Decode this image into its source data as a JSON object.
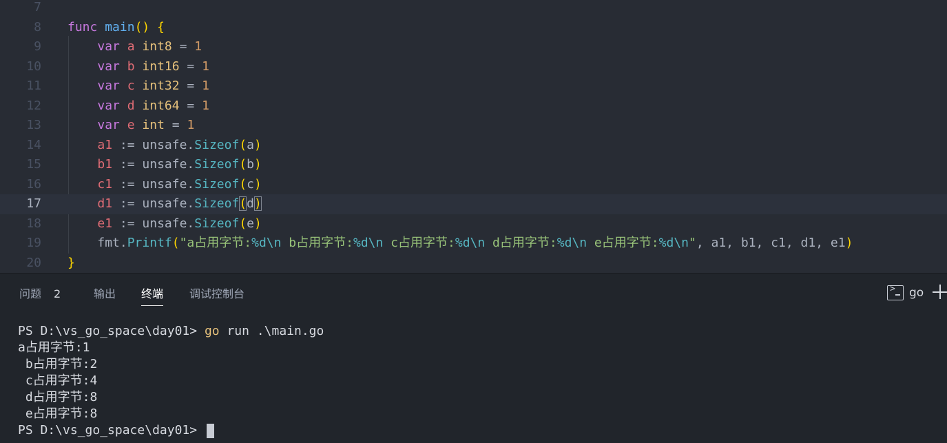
{
  "editor": {
    "lines": [
      {
        "n": "7",
        "tokens": []
      },
      {
        "n": "8",
        "tokens": [
          {
            "t": "func",
            "c": "kw"
          },
          {
            "t": " ",
            "c": "pl"
          },
          {
            "t": "main",
            "c": "fn"
          },
          {
            "t": "()",
            "c": "brk"
          },
          {
            "t": " ",
            "c": "pl"
          },
          {
            "t": "{",
            "c": "brk"
          }
        ]
      },
      {
        "n": "9",
        "tokens": [
          {
            "t": "    ",
            "c": "pl"
          },
          {
            "t": "var",
            "c": "kw"
          },
          {
            "t": " ",
            "c": "pl"
          },
          {
            "t": "a",
            "c": "var"
          },
          {
            "t": " ",
            "c": "pl"
          },
          {
            "t": "int8",
            "c": "typ"
          },
          {
            "t": " = ",
            "c": "pl"
          },
          {
            "t": "1",
            "c": "num"
          }
        ]
      },
      {
        "n": "10",
        "tokens": [
          {
            "t": "    ",
            "c": "pl"
          },
          {
            "t": "var",
            "c": "kw"
          },
          {
            "t": " ",
            "c": "pl"
          },
          {
            "t": "b",
            "c": "var"
          },
          {
            "t": " ",
            "c": "pl"
          },
          {
            "t": "int16",
            "c": "typ"
          },
          {
            "t": " = ",
            "c": "pl"
          },
          {
            "t": "1",
            "c": "num"
          }
        ]
      },
      {
        "n": "11",
        "tokens": [
          {
            "t": "    ",
            "c": "pl"
          },
          {
            "t": "var",
            "c": "kw"
          },
          {
            "t": " ",
            "c": "pl"
          },
          {
            "t": "c",
            "c": "var"
          },
          {
            "t": " ",
            "c": "pl"
          },
          {
            "t": "int32",
            "c": "typ"
          },
          {
            "t": " = ",
            "c": "pl"
          },
          {
            "t": "1",
            "c": "num"
          }
        ]
      },
      {
        "n": "12",
        "tokens": [
          {
            "t": "    ",
            "c": "pl"
          },
          {
            "t": "var",
            "c": "kw"
          },
          {
            "t": " ",
            "c": "pl"
          },
          {
            "t": "d",
            "c": "var"
          },
          {
            "t": " ",
            "c": "pl"
          },
          {
            "t": "int64",
            "c": "typ"
          },
          {
            "t": " = ",
            "c": "pl"
          },
          {
            "t": "1",
            "c": "num"
          }
        ]
      },
      {
        "n": "13",
        "tokens": [
          {
            "t": "    ",
            "c": "pl"
          },
          {
            "t": "var",
            "c": "kw"
          },
          {
            "t": " ",
            "c": "pl"
          },
          {
            "t": "e",
            "c": "var"
          },
          {
            "t": " ",
            "c": "pl"
          },
          {
            "t": "int",
            "c": "typ"
          },
          {
            "t": " = ",
            "c": "pl"
          },
          {
            "t": "1",
            "c": "num"
          }
        ]
      },
      {
        "n": "14",
        "tokens": [
          {
            "t": "    ",
            "c": "pl"
          },
          {
            "t": "a1",
            "c": "var"
          },
          {
            "t": " := unsafe.",
            "c": "pl"
          },
          {
            "t": "Sizeof",
            "c": "meth"
          },
          {
            "t": "(",
            "c": "brk"
          },
          {
            "t": "a",
            "c": "pl"
          },
          {
            "t": ")",
            "c": "brk"
          }
        ]
      },
      {
        "n": "15",
        "tokens": [
          {
            "t": "    ",
            "c": "pl"
          },
          {
            "t": "b1",
            "c": "var"
          },
          {
            "t": " := unsafe.",
            "c": "pl"
          },
          {
            "t": "Sizeof",
            "c": "meth"
          },
          {
            "t": "(",
            "c": "brk"
          },
          {
            "t": "b",
            "c": "pl"
          },
          {
            "t": ")",
            "c": "brk"
          }
        ]
      },
      {
        "n": "16",
        "tokens": [
          {
            "t": "    ",
            "c": "pl"
          },
          {
            "t": "c1",
            "c": "var"
          },
          {
            "t": " := unsafe.",
            "c": "pl"
          },
          {
            "t": "Sizeof",
            "c": "meth"
          },
          {
            "t": "(",
            "c": "brk"
          },
          {
            "t": "c",
            "c": "pl"
          },
          {
            "t": ")",
            "c": "brk"
          }
        ]
      },
      {
        "n": "17",
        "current": true,
        "tokens": [
          {
            "t": "    ",
            "c": "pl"
          },
          {
            "t": "d1",
            "c": "var"
          },
          {
            "t": " := unsafe.",
            "c": "pl"
          },
          {
            "t": "Sizeof",
            "c": "meth"
          },
          {
            "t": "(",
            "c": "brk bracket-match"
          },
          {
            "t": "d",
            "c": "pl"
          },
          {
            "t": ")",
            "c": "brk bracket-match"
          }
        ]
      },
      {
        "n": "18",
        "tokens": [
          {
            "t": "    ",
            "c": "pl"
          },
          {
            "t": "e1",
            "c": "var"
          },
          {
            "t": " := unsafe.",
            "c": "pl"
          },
          {
            "t": "Sizeof",
            "c": "meth"
          },
          {
            "t": "(",
            "c": "brk"
          },
          {
            "t": "e",
            "c": "pl"
          },
          {
            "t": ")",
            "c": "brk"
          }
        ]
      },
      {
        "n": "19",
        "tokens": [
          {
            "t": "    ",
            "c": "pl"
          },
          {
            "t": "fmt.",
            "c": "pl"
          },
          {
            "t": "Printf",
            "c": "meth"
          },
          {
            "t": "(",
            "c": "brk"
          },
          {
            "t": "\"a占用字节:",
            "c": "str"
          },
          {
            "t": "%d\\n",
            "c": "esc"
          },
          {
            "t": " b占用字节:",
            "c": "str"
          },
          {
            "t": "%d\\n",
            "c": "esc"
          },
          {
            "t": " c占用字节:",
            "c": "str"
          },
          {
            "t": "%d\\n",
            "c": "esc"
          },
          {
            "t": " d占用字节:",
            "c": "str"
          },
          {
            "t": "%d\\n",
            "c": "esc"
          },
          {
            "t": " e占用字节:",
            "c": "str"
          },
          {
            "t": "%d\\n",
            "c": "esc"
          },
          {
            "t": "\"",
            "c": "str"
          },
          {
            "t": ", a1, b1, c1, d1, e1",
            "c": "pl"
          },
          {
            "t": ")",
            "c": "brk"
          }
        ]
      },
      {
        "n": "20",
        "tokens": [
          {
            "t": "}",
            "c": "brk"
          }
        ]
      }
    ]
  },
  "panel": {
    "tabs": {
      "problems": "问题",
      "problems_count": "2",
      "output": "输出",
      "terminal": "终端",
      "debug_console": "调试控制台"
    },
    "terminal_selector": {
      "label": "go",
      "icon": "terminal-icon"
    },
    "add_icon": "plus-icon"
  },
  "terminal": {
    "prompt1": "PS D:\\vs_go_space\\day01> ",
    "command": "go",
    "command_args": " run .\\main.go",
    "output": [
      "a占用字节:1",
      " b占用字节:2",
      " c占用字节:4",
      " d占用字节:8",
      " e占用字节:8"
    ],
    "prompt2": "PS D:\\vs_go_space\\day01> "
  }
}
